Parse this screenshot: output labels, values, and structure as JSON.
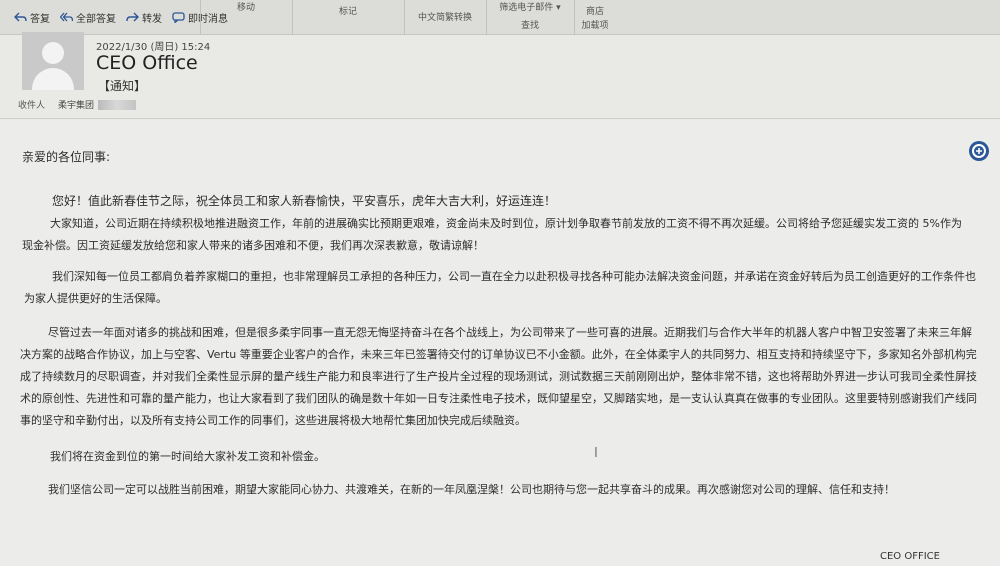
{
  "toolbar": {
    "reply": "答复",
    "reply_all": "全部答复",
    "forward": "转发",
    "im": "即时消息",
    "groups": [
      {
        "top": "移动",
        "bottom": ""
      },
      {
        "top": "",
        "bottom": "标记"
      },
      {
        "top": "中文简繁转换",
        "bottom": ""
      },
      {
        "top": "筛选电子邮件 ▾",
        "bottom": "查找"
      },
      {
        "top": "商店",
        "bottom": "加载项"
      }
    ]
  },
  "message": {
    "date": "2022/1/30 (周日) 15:24",
    "sender": "CEO Office",
    "subject": "【通知】",
    "to_label": "收件人",
    "to_value": "柔宇集团"
  },
  "body": {
    "greeting": "亲爱的各位同事:",
    "paragraphs": [
      "您好！值此新春佳节之际，祝全体员工和家人新春愉快，平安喜乐，虎年大吉大利，好运连连！",
      "大家知道，公司近期在持续积极地推进融资工作，年前的进展确实比预期更艰难，资金尚未及时到位，原计划争取春节前发放的工资不得不再次延缓。公司将给予您延缓实发工资的 5%作为现金补偿。因工资延缓发放给您和家人带来的诸多困难和不便，我们再次深表歉意，敬请谅解！",
      "我们深知每一位员工都肩负着养家糊口的重担，也非常理解员工承担的各种压力，公司一直在全力以赴积极寻找各种可能办法解决资金问题，并承诺在资金好转后为员工创造更好的工作条件也为家人提供更好的生活保障。",
      "尽管过去一年面对诸多的挑战和困难，但是很多柔宇同事一直无怨无悔坚持奋斗在各个战线上，为公司带来了一些可喜的进展。近期我们与合作大半年的机器人客户中智卫安签署了未来三年解决方案的战略合作协议，加上与空客、Vertu 等重要企业客户的合作，未来三年已签署待交付的订单协议已不小金额。此外，在全体柔宇人的共同努力、相互支持和持续坚守下，多家知名外部机构完成了持续数月的尽职调查，并对我们全柔性显示屏的量产线生产能力和良率进行了生产投片全过程的现场测试，测试数据三天前刚刚出炉，整体非常不错，这也将帮助外界进一步认可我司全柔性屏技术的原创性、先进性和可靠的量产能力，也让大家看到了我们团队的确是数十年如一日专注柔性电子技术，既仰望星空，又脚踏实地，是一支认认真真在做事的专业团队。这里要特别感谢我们产线同事的坚守和辛勤付出，以及所有支持公司工作的同事们，这些进展将极大地帮忙集团加快完成后续融资。",
      "我们将在资金到位的第一时间给大家补发工资和补偿金。",
      "我们坚信公司一定可以战胜当前困难，期望大家能同心协力、共渡难关，在新的一年凤凰涅槃！公司也期待与您一起共享奋斗的成果。再次感谢您对公司的理解、信任和支持！"
    ],
    "signature": "CEO OFFICE"
  },
  "icons": {
    "reply": "reply-icon",
    "reply_all": "reply-all-icon",
    "forward": "forward-icon",
    "im": "chat-icon",
    "assistant": "assistant-icon"
  },
  "colors": {
    "accent": "#2b5797"
  }
}
